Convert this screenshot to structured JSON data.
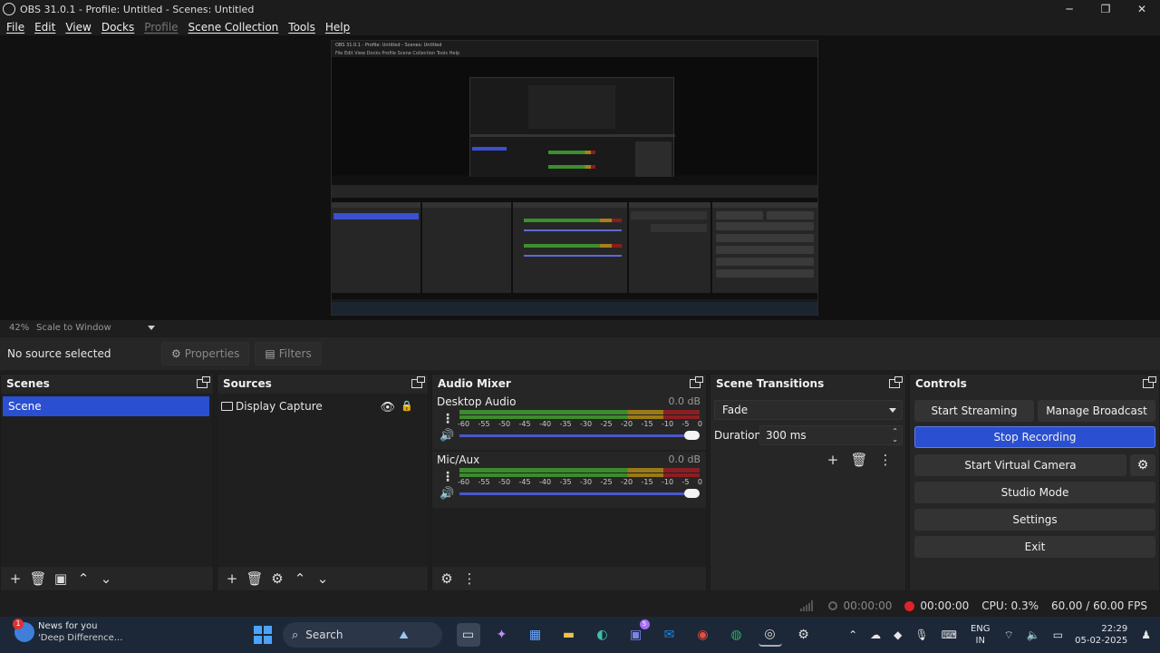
{
  "window": {
    "title": "OBS 31.0.1 - Profile: Untitled - Scenes: Untitled",
    "minimize": "─",
    "maximize": "❐",
    "close": "✕"
  },
  "menu": [
    "File",
    "Edit",
    "View",
    "Docks",
    "Profile",
    "Scene Collection",
    "Tools",
    "Help"
  ],
  "preview": {
    "zoom": "42%",
    "scale_mode": "Scale to Window",
    "nested_title": "OBS 31.0.1 - Profile: Untitled - Scenes: Untitled",
    "nested_menu": "File  Edit  View  Docks  Profile  Scene Collection  Tools  Help"
  },
  "source_toolbar": {
    "no_source": "No source selected",
    "properties": "Properties",
    "filters": "Filters"
  },
  "scenes": {
    "title": "Scenes",
    "items": [
      "Scene"
    ]
  },
  "sources": {
    "title": "Sources",
    "items": [
      "Display Capture"
    ]
  },
  "mixer": {
    "title": "Audio Mixer",
    "ticks": [
      "-60",
      "-55",
      "-50",
      "-45",
      "-40",
      "-35",
      "-30",
      "-25",
      "-20",
      "-15",
      "-10",
      "-5",
      "0"
    ],
    "channels": [
      {
        "name": "Desktop Audio",
        "db": "0.0 dB"
      },
      {
        "name": "Mic/Aux",
        "db": "0.0 dB"
      }
    ]
  },
  "transitions": {
    "title": "Scene Transitions",
    "selected": "Fade",
    "duration_label": "Duration",
    "duration_value": "300 ms"
  },
  "controls": {
    "title": "Controls",
    "start_streaming": "Start Streaming",
    "manage_broadcast": "Manage Broadcast",
    "stop_recording": "Stop Recording",
    "start_virtual_camera": "Start Virtual Camera",
    "studio_mode": "Studio Mode",
    "settings": "Settings",
    "exit": "Exit"
  },
  "status": {
    "stream_time": "00:00:00",
    "rec_time": "00:00:00",
    "cpu": "CPU: 0.3%",
    "fps": "60.00 / 60.00 FPS"
  },
  "taskbar": {
    "news_title": "News for you",
    "news_sub": "'Deep Difference...",
    "news_badge": "1",
    "search": "Search",
    "lang_1": "ENG",
    "lang_2": "IN",
    "time": "22:29",
    "date": "05-02-2025",
    "teams_badge": "5"
  },
  "colors": {
    "accent": "#2a4fd0",
    "record": "#e0222b"
  }
}
